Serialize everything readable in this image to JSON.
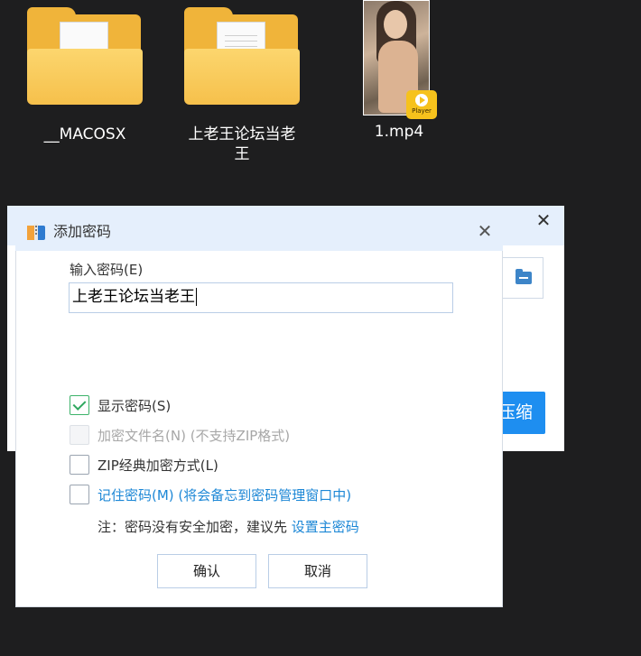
{
  "desktop": {
    "items": [
      {
        "label": "__MACOSX",
        "type": "folder"
      },
      {
        "label": "上老王论坛当老王",
        "type": "folder"
      },
      {
        "label": "1.mp4",
        "type": "video",
        "badge": "Player"
      }
    ]
  },
  "background_window": {
    "action_button": "压缩",
    "close_icon": "close-icon"
  },
  "dialog": {
    "title": "添加密码",
    "password_label": "输入密码(E)",
    "password_value": "上老王论坛当老王",
    "options": [
      {
        "label": "显示密码(S)",
        "checked": true,
        "enabled": true
      },
      {
        "label": "加密文件名(N) (不支持ZIP格式)",
        "checked": false,
        "enabled": false
      },
      {
        "label": "ZIP经典加密方式(L)",
        "checked": false,
        "enabled": true
      },
      {
        "label": "记住密码(M) (将会备忘到密码管理窗口中)",
        "checked": false,
        "enabled": true
      }
    ],
    "note_prefix": "注：密码没有安全加密，建议先",
    "note_link": "设置主密码",
    "ok_button": "确认",
    "cancel_button": "取消"
  },
  "colors": {
    "accent": "#1e8ef0",
    "link": "#1c87d6",
    "titlebar": "#e5effc",
    "check": "#2fa85f"
  }
}
